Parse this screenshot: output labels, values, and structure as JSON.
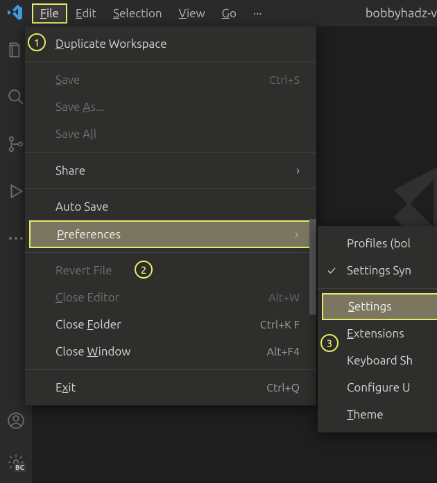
{
  "menubar": {
    "items": [
      {
        "label": "File",
        "mnemonic": "F",
        "active": true
      },
      {
        "label": "Edit",
        "mnemonic": "E"
      },
      {
        "label": "Selection",
        "mnemonic": "S"
      },
      {
        "label": "View",
        "mnemonic": "V"
      },
      {
        "label": "Go",
        "mnemonic": "G"
      }
    ],
    "overflow": "···",
    "title_right": "bobbyhadz-v"
  },
  "file_menu": {
    "items": [
      {
        "label": "Duplicate Workspace",
        "mnemonic": "D"
      },
      {
        "sep": true
      },
      {
        "label": "Save",
        "mnemonic": "S",
        "shortcut": "Ctrl+S",
        "disabled": true
      },
      {
        "label": "Save As...",
        "mnemonic": "A",
        "disabled": true
      },
      {
        "label": "Save All",
        "mnemonic": "l",
        "disabled": true
      },
      {
        "sep": true
      },
      {
        "label": "Share",
        "submenu": true
      },
      {
        "sep": true
      },
      {
        "label": "Auto Save"
      },
      {
        "label": "Preferences",
        "mnemonic": "P",
        "submenu": true,
        "highlight": true
      },
      {
        "sep": true
      },
      {
        "label": "Revert File",
        "mnemonic": "",
        "disabled": true
      },
      {
        "label": "Close Editor",
        "mnemonic": "C",
        "shortcut": "Alt+W",
        "disabled": true
      },
      {
        "label": "Close Folder",
        "mnemonic": "F",
        "shortcut": "Ctrl+K F"
      },
      {
        "label": "Close Window",
        "mnemonic": "W",
        "shortcut": "Alt+F4"
      },
      {
        "sep": true
      },
      {
        "label": "Exit",
        "mnemonic": "x",
        "shortcut": "Ctrl+Q"
      }
    ]
  },
  "preferences_submenu": {
    "items": [
      {
        "label": "Profiles (bol"
      },
      {
        "label": "Settings Syn",
        "checked": true
      },
      {
        "sep": true
      },
      {
        "label": "Settings",
        "mnemonic": "S",
        "highlight": true
      },
      {
        "label": "Extensions",
        "mnemonic": "E"
      },
      {
        "label": "Keyboard Sh"
      },
      {
        "label": "Configure U"
      },
      {
        "label": "Theme",
        "mnemonic": "T"
      }
    ]
  },
  "annotations": {
    "a1": "1",
    "a2": "2",
    "a3": "3"
  },
  "badge": "BC"
}
